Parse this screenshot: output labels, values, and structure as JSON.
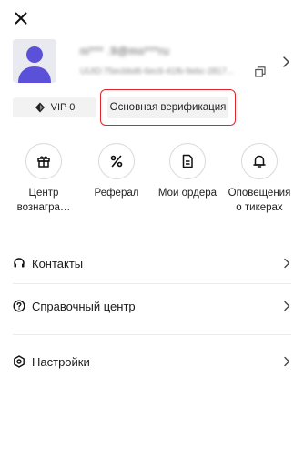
{
  "header": {
    "close_icon": "close-icon"
  },
  "profile": {
    "email": "ni*** .9@mo***ru",
    "uid": "UUID:75ecbbd6-6ec6-41fb-9ebc-2817...",
    "avatar_color": "#5b51d8"
  },
  "badges": {
    "vip_label": "VIP 0",
    "verify_label": "Основная верификация",
    "highlight_color": "#e0242b"
  },
  "shortcuts": [
    {
      "label": "Центр вознагра…",
      "icon": "gift-icon"
    },
    {
      "label": "Реферал",
      "icon": "percent-icon"
    },
    {
      "label": "Мои ордера",
      "icon": "document-icon"
    },
    {
      "label": "Оповещения о тикерах",
      "icon": "bell-icon"
    }
  ],
  "menu": {
    "contacts": "Контакты",
    "help": "Справочный центр",
    "settings": "Настройки"
  }
}
